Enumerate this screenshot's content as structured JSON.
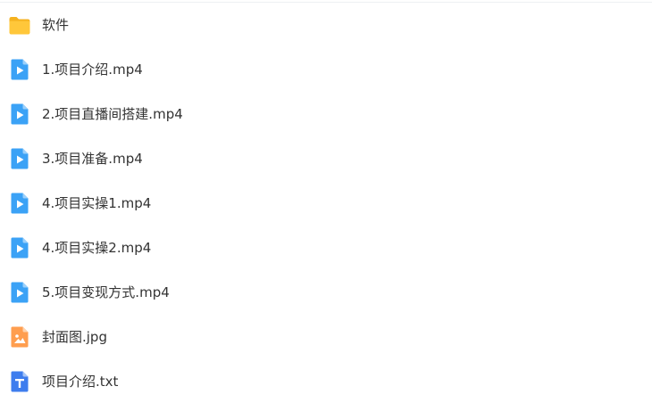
{
  "colors": {
    "folder": "#FFC73A",
    "folder_dark": "#F5B21F",
    "video": "#3BA2F6",
    "video_fold": "#9BD0FB",
    "image": "#FF9E4F",
    "image_fold": "#FFD3AE",
    "text_doc": "#3E7DEE",
    "text_doc_fold": "#A7C5F8",
    "text": "#333333"
  },
  "files": [
    {
      "name": "软件",
      "type": "folder",
      "icon": "folder-icon"
    },
    {
      "name": "1.项目介绍.mp4",
      "type": "video",
      "icon": "video-file-icon"
    },
    {
      "name": "2.项目直播间搭建.mp4",
      "type": "video",
      "icon": "video-file-icon"
    },
    {
      "name": "3.项目准备.mp4",
      "type": "video",
      "icon": "video-file-icon"
    },
    {
      "name": "4.项目实操1.mp4",
      "type": "video",
      "icon": "video-file-icon"
    },
    {
      "name": "4.项目实操2.mp4",
      "type": "video",
      "icon": "video-file-icon"
    },
    {
      "name": "5.项目变现方式.mp4",
      "type": "video",
      "icon": "video-file-icon"
    },
    {
      "name": "封面图.jpg",
      "type": "image",
      "icon": "image-file-icon"
    },
    {
      "name": "项目介绍.txt",
      "type": "text",
      "icon": "text-file-icon"
    }
  ]
}
